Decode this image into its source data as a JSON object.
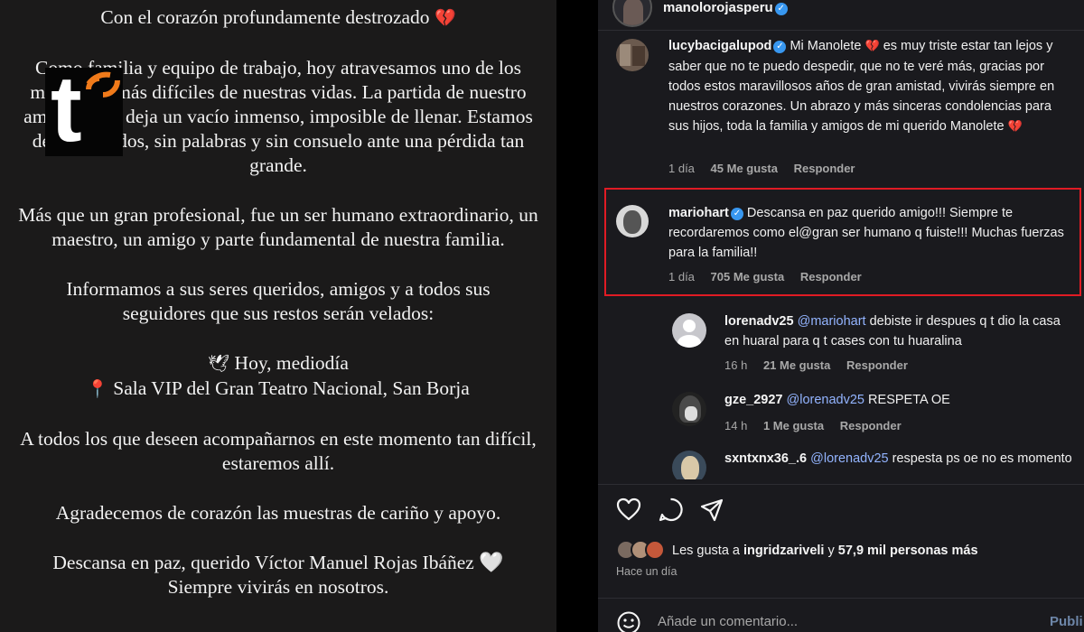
{
  "statement": {
    "line1": "Con el corazón profundamente destrozado",
    "para2": "Como familia y equipo de trabajo, hoy atravesamos uno de los momentos más difíciles de nuestras vidas. La partida de nuestro amigo y jefe deja un vacío inmenso, imposible de llenar. Estamos desconsolados, sin palabras y sin consuelo ante una pérdida tan grande.",
    "para3": "Más que un gran profesional, fue un ser humano extraordinario, un maestro, un amigo y parte fundamental de nuestra familia.",
    "para4": "Informamos a sus seres queridos, amigos y a todos sus seguidores que sus restos serán velados:",
    "when": "Hoy, mediodía",
    "where": "Sala VIP del Gran Teatro Nacional, San Borja",
    "para6": "A todos los que deseen acompañarnos en este momento tan difícil, estaremos allí.",
    "para7": "Agradecemos de corazón las muestras de cariño y apoyo.",
    "para8a": "Descansa en paz, querido Víctor Manuel Rojas Ibáñez",
    "para8b": "Siempre vivirás en nosotros."
  },
  "logo": {
    "letter": "t"
  },
  "post": {
    "author": "manolorojasperu"
  },
  "comments": [
    {
      "user": "lucybacigalupod",
      "text_a": "Mi Manolete",
      "text_b": "es muy triste estar tan lejos y saber que no te puedo despedir, que no te veré más, gracias por todos estos maravillosos años de gran amistad, vivirás siempre en nuestros corazones. Un abrazo y más sinceras condolencias para sus hijos, toda la familia y amigos de mi querido Manolete",
      "time": "1 día",
      "likes": "45 Me gusta",
      "reply": "Responder"
    },
    {
      "user": "mariohart",
      "text": "Descansa en paz querido amigo!!! Siempre te recordaremos como el@gran ser humano q fuiste!!! Muchas fuerzas para la familia!!",
      "time": "1 día",
      "likes": "705 Me gusta",
      "reply": "Responder"
    }
  ],
  "replies": [
    {
      "user": "lorenadv25",
      "mention": "@mariohart",
      "text": "debiste ir despues q t dio la casa en huaral para q t cases con tu huaralina",
      "time": "16 h",
      "likes": "21 Me gusta",
      "reply": "Responder"
    },
    {
      "user": "gze_2927",
      "mention": "@lorenadv25",
      "text": "RESPETA OE",
      "time": "14 h",
      "likes": "1 Me gusta",
      "reply": "Responder"
    },
    {
      "user": "sxntxnx36_.6",
      "mention": "@lorenadv25",
      "text": "respesta ps oe no es momento"
    }
  ],
  "likes_summary": {
    "prefix": "Les gusta a",
    "user": "ingridzariveli",
    "middle": "y",
    "rest": "57,9 mil personas más"
  },
  "posted": "Hace un día",
  "comment_box": {
    "placeholder": "Añade un comentario...",
    "publish": "Publi"
  },
  "icons": [
    "heart-outline-icon",
    "comment-bubble-icon",
    "share-send-icon",
    "emoji-icon",
    "verified-badge-icon"
  ],
  "colors": {
    "highlight": "#e01b24",
    "verified": "#3897f0",
    "mention": "#93b4ff",
    "logo_orange": "#f07a1a"
  }
}
